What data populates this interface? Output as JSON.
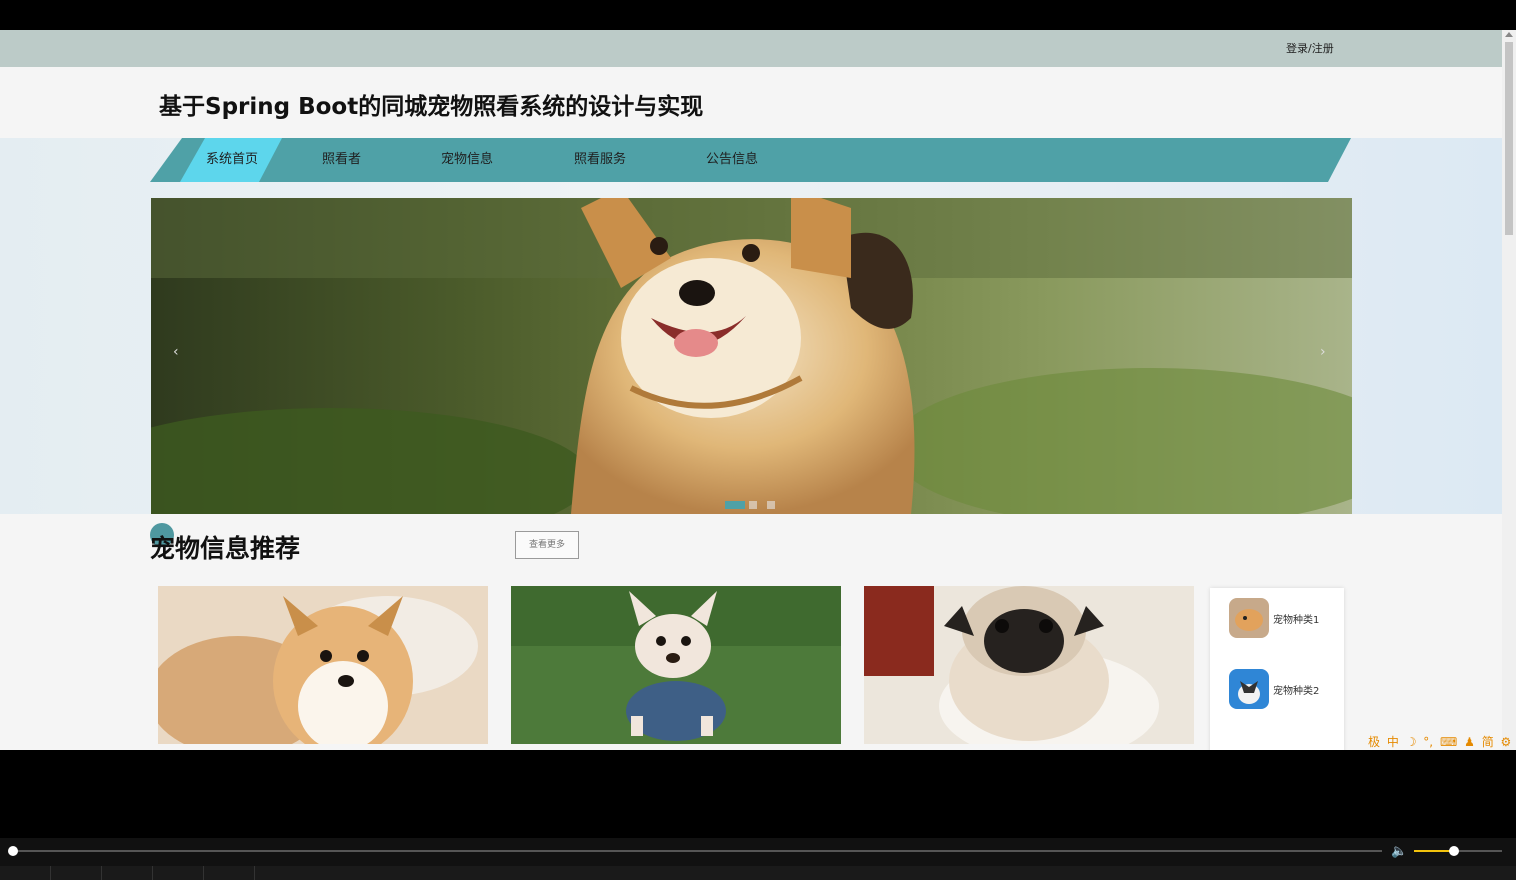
{
  "topbar": {
    "login_label": "登录/注册"
  },
  "header": {
    "title": "基于Spring Boot的同城宠物照看系统的设计与实现"
  },
  "nav": {
    "items": [
      {
        "label": "系统首页",
        "active": true
      },
      {
        "label": "照看者",
        "active": false
      },
      {
        "label": "宠物信息",
        "active": false
      },
      {
        "label": "照看服务",
        "active": false
      },
      {
        "label": "公告信息",
        "active": false
      }
    ]
  },
  "carousel": {
    "prev_label": "‹",
    "next_label": "›",
    "slide_count": 3,
    "active_slide": 1,
    "image": "corgi-running-photo"
  },
  "section": {
    "title": "宠物信息推荐",
    "more_label": "查看更多",
    "cards": [
      {
        "image": "corgi-puppy-photo"
      },
      {
        "image": "french-bulldog-puppy-photo"
      },
      {
        "image": "pug-puppy-photo"
      }
    ],
    "categories": [
      {
        "label": "宠物种类1",
        "image": "dog-thumbnail"
      },
      {
        "label": "宠物种类2",
        "image": "husky-thumbnail"
      }
    ]
  },
  "ime": {
    "items": [
      "极",
      "中",
      "☽",
      "°,",
      "⌨",
      "♟",
      "简",
      "⚙"
    ]
  },
  "player": {
    "volume_icon": "🔈",
    "volume_fraction": 0.45,
    "progress_fraction": 0.0
  },
  "colors": {
    "nav": "#4fa1a7",
    "nav_active": "#5dd6ec",
    "topbar": "#bccbc8",
    "accent": "#f2c20d"
  }
}
